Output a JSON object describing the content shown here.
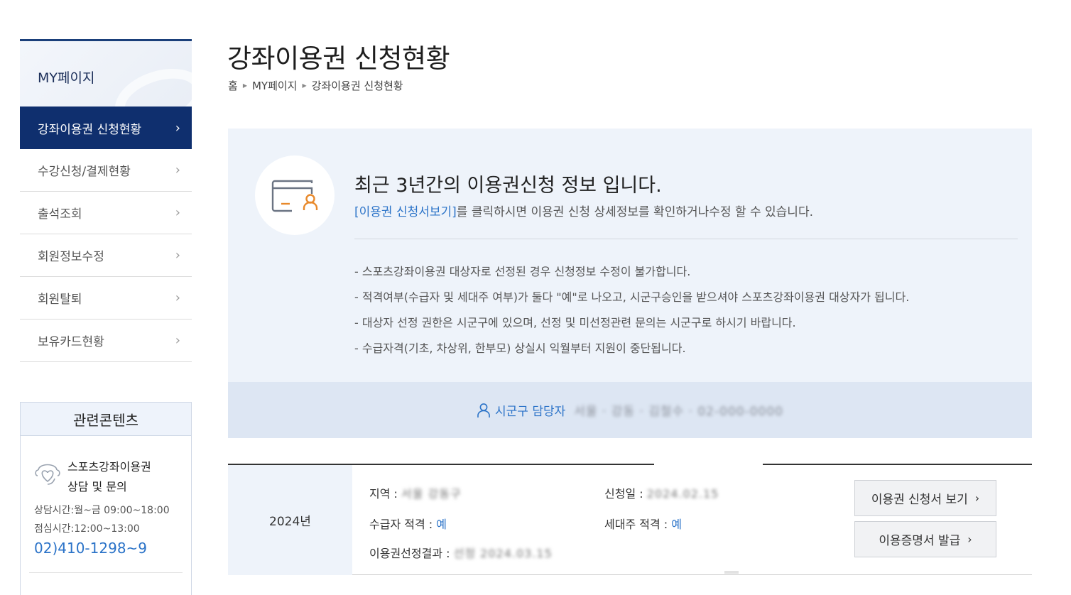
{
  "page": {
    "title": "강좌이용권 신청현황",
    "breadcrumb": [
      "홈",
      "MY페이지",
      "강좌이용권 신청현황"
    ]
  },
  "sidebar": {
    "heading": "MY페이지",
    "items": [
      {
        "label": "강좌이용권 신청현황",
        "active": true
      },
      {
        "label": "수강신청/결제현황",
        "active": false
      },
      {
        "label": "출석조회",
        "active": false
      },
      {
        "label": "회원정보수정",
        "active": false
      },
      {
        "label": "회원탈퇴",
        "active": false
      },
      {
        "label": "보유카드현황",
        "active": false
      }
    ],
    "chevron": "›"
  },
  "related": {
    "heading": "관련콘텐츠",
    "title_line1": "스포츠강좌이용권",
    "title_line2": "상담 및 문의",
    "hours": "상담시간:월~금 09:00~18:00",
    "lunch": "점심시간:12:00~13:00",
    "phone": "02)410-1298~9",
    "icon": "support-heart-icon"
  },
  "info": {
    "title": "최근 3년간의 이용권신청 정보 입니다.",
    "link_text": "[이용권 신청서보기]",
    "sub_text": "를 클릭하시면 이용권 신청 상세정보를 확인하거나수정 할 수 있습니다.",
    "icon": "card-user-icon",
    "notes": [
      "- 스포츠강좌이용권 대상자로 선정된 경우 신청정보 수정이 불가합니다.",
      "- 적격여부(수급자 및 세대주 여부)가 둘다 \"예\"로 나오고, 시군구승인을 받으셔야 스포츠강좌이용권 대상자가 됩니다.",
      "- 대상자 선정 권한은 시군구에 있으며, 선정 및 미선정관련 문의는 시군구로 하시기 바랍니다.",
      "- 수급자격(기초, 차상위, 한부모) 상실시 익월부터 지원이 중단됩니다."
    ],
    "manager_label": "시군구 담당자",
    "manager_value": "서울 · 강동 · 김철수 · 02-000-0000"
  },
  "record": {
    "year": "2024년",
    "region_label": "지역 :",
    "region_value": "서울 강동구",
    "apply_date_label": "신청일 :",
    "apply_date_value": "2024.02.15",
    "recipient_label": "수급자 적격 :",
    "recipient_value": "예",
    "householder_label": "세대주 적격 :",
    "householder_value": "예",
    "result_label": "이용권선정결과 :",
    "result_value": "선정 2024.03.15",
    "btn_view": "이용권 신청서 보기",
    "btn_cert": "이용증명서 발급",
    "btn_arrow": "›"
  }
}
